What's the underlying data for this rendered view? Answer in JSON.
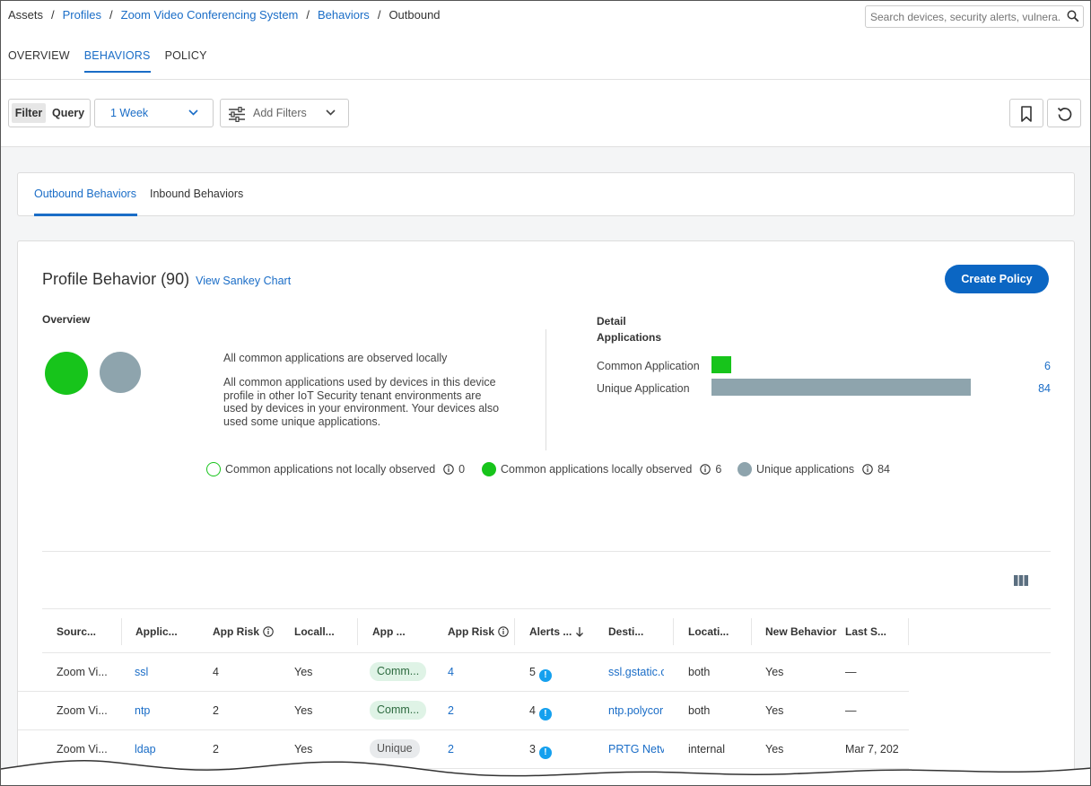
{
  "breadcrumb": {
    "items": [
      "Assets",
      "Profiles",
      "Zoom Video Conferencing System",
      "Behaviors",
      "Outbound"
    ],
    "sep": "/"
  },
  "search": {
    "placeholder": "Search devices, security alerts, vulnera..."
  },
  "main_tabs": [
    "OVERVIEW",
    "BEHAVIORS",
    "POLICY"
  ],
  "toolbar": {
    "filter": "Filter",
    "query": "Query",
    "time_range": "1 Week",
    "add_filters": "Add Filters"
  },
  "sub_tabs": [
    "Outbound Behaviors",
    "Inbound Behaviors"
  ],
  "card": {
    "title": "Profile Behavior (90)",
    "sankey_link": "View Sankey Chart",
    "create_button": "Create Policy",
    "overview_label": "Overview",
    "overview_text1": "All common applications are observed locally",
    "overview_text2": "All common applications used by devices in this device profile in other IoT Security tenant environments are used by devices in your environment. Your devices also used some unique applications.",
    "detail_label_1": "Detail",
    "detail_label_2": "Applications",
    "bars": [
      {
        "label": "Common Application",
        "value": "6",
        "fraction": 0.071,
        "color": "#17c41b"
      },
      {
        "label": "Unique Application",
        "value": "84",
        "fraction": 1.0,
        "color": "#8ea4ad"
      }
    ],
    "legend": [
      {
        "label": "Common applications not locally observed",
        "value": "0"
      },
      {
        "label": "Common applications locally observed",
        "value": "6"
      },
      {
        "label": "Unique applications",
        "value": "84"
      }
    ]
  },
  "colors": {
    "accent": "#1a6dc7",
    "common_green": "#17c41b",
    "unique_gray": "#8ea4ad",
    "alert_blue": "#15a0ee",
    "button_blue": "#0b66c3"
  },
  "table": {
    "headers": [
      "Sourc...",
      "Applic...",
      "App Risk",
      "Locall...",
      "App ...",
      "App Risk",
      "Alerts ...",
      "Desti...",
      "Locati...",
      "New Behavior",
      "Last S..."
    ],
    "rows": [
      [
        "Zoom Vi...",
        "ssl",
        "4",
        "Yes",
        "Comm...",
        "4",
        "5",
        "ssl.gstatic.c",
        "both",
        "Yes",
        "—"
      ],
      [
        "Zoom Vi...",
        "ntp",
        "2",
        "Yes",
        "Comm...",
        "2",
        "4",
        "ntp.polycor",
        "both",
        "Yes",
        "—"
      ],
      [
        "Zoom Vi...",
        "ldap",
        "2",
        "Yes",
        "Unique",
        "2",
        "3",
        "PRTG Netv",
        "internal",
        "Yes",
        "Mar 7, 202"
      ]
    ]
  }
}
